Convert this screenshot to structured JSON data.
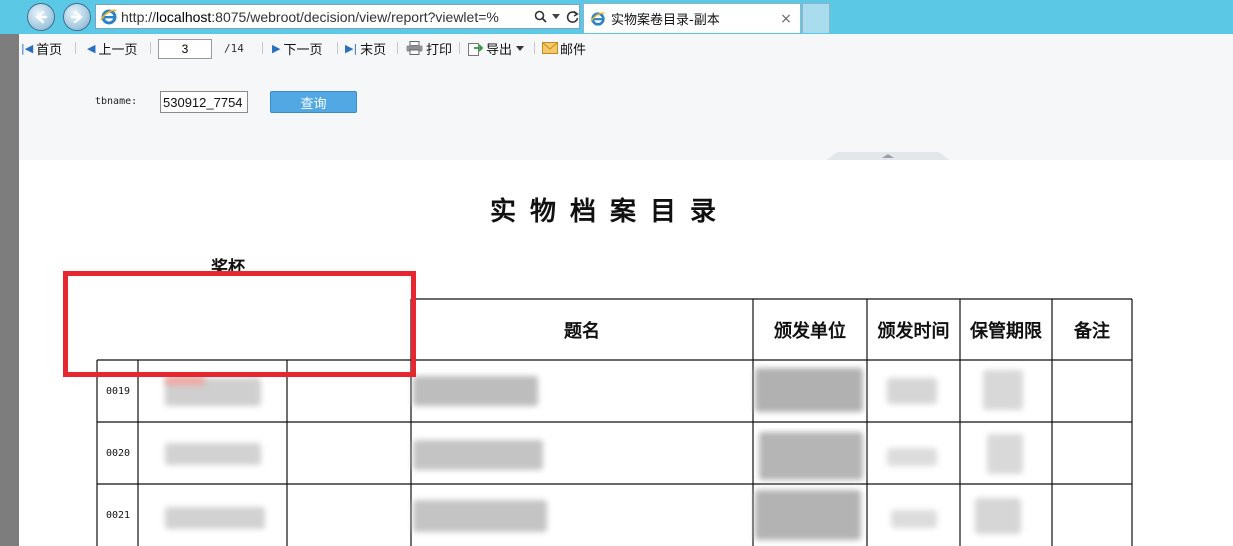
{
  "browser": {
    "url_prefix": "http://",
    "url_host": "localhost",
    "url_rest": ":8075/webroot/decision/view/report?viewlet=%",
    "tab_title": "实物案卷目录-副本",
    "tab_close": "×",
    "icons": [
      "back-icon",
      "forward-icon",
      "ie-icon",
      "search-icon",
      "dropdown-icon",
      "refresh-icon",
      "close-icon"
    ],
    "chrome_color": "#5bc8e6"
  },
  "toolbar": {
    "first": "首页",
    "prev": "上一页",
    "page_value": "3",
    "total": "/14",
    "next": "下一页",
    "last": "末页",
    "print": "打印",
    "export": "导出",
    "mail": "邮件",
    "param_label": "tbname:",
    "param_value": "530912_7754",
    "query": "查询",
    "accent_color": "#52a8e3"
  },
  "report": {
    "title": "实物档案目录",
    "subtitle": "奖杯",
    "columns": [
      "题名",
      "颁发单位",
      "颁发时间",
      "保管期限",
      "备注"
    ],
    "rows": [
      {
        "no": "0019"
      },
      {
        "no": "0020"
      },
      {
        "no": "0021"
      }
    ],
    "highlight_color": "#e8262e"
  }
}
